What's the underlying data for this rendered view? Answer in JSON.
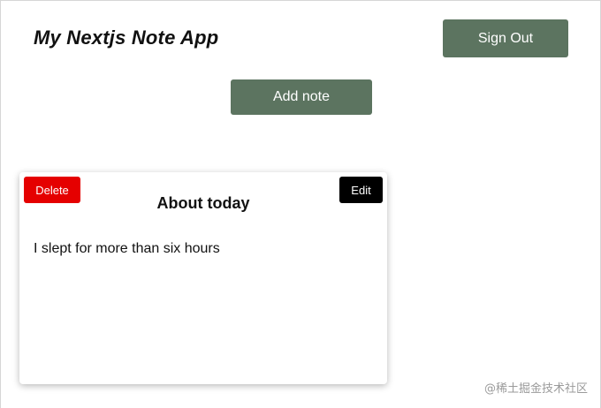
{
  "header": {
    "app_title": "My Nextjs Note App",
    "signout_label": "Sign Out"
  },
  "toolbar": {
    "add_note_label": "Add note"
  },
  "notes": [
    {
      "delete_label": "Delete",
      "edit_label": "Edit",
      "title": "About today",
      "body": "I slept for more than six hours"
    }
  ],
  "watermark": {
    "text": "@稀土掘金技术社区"
  },
  "colors": {
    "primary_button": "#5c7460",
    "delete_button": "#e50000",
    "edit_button": "#000000"
  }
}
